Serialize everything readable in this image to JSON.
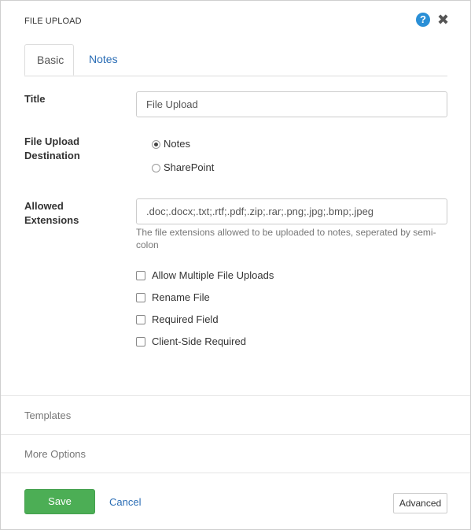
{
  "dialog": {
    "title": "FILE UPLOAD",
    "help_glyph": "?",
    "close_glyph": "✖"
  },
  "tabs": [
    {
      "label": "Basic",
      "active": true
    },
    {
      "label": "Notes",
      "active": false
    }
  ],
  "form": {
    "title": {
      "label": "Title",
      "value": "File Upload"
    },
    "destination": {
      "label_line1": "File Upload",
      "label_line2": "Destination",
      "options": [
        {
          "label": "Notes",
          "selected": true
        },
        {
          "label": "SharePoint",
          "selected": false
        }
      ]
    },
    "extensions": {
      "label_line1": "Allowed",
      "label_line2": "Extensions",
      "value": ".doc;.docx;.txt;.rtf;.pdf;.zip;.rar;.png;.jpg;.bmp;.jpeg",
      "help_text": "The file extensions allowed to be uploaded to notes, seperated by semi-colon"
    },
    "checkboxes": [
      {
        "label": "Allow Multiple File Uploads",
        "checked": false
      },
      {
        "label": "Rename File",
        "checked": false
      },
      {
        "label": "Required Field",
        "checked": false
      },
      {
        "label": "Client-Side Required",
        "checked": false
      }
    ]
  },
  "sections": {
    "templates": "Templates",
    "more_options": "More Options"
  },
  "footer": {
    "save_label": "Save",
    "cancel_label": "Cancel",
    "advanced_label": "Advanced"
  },
  "colors": {
    "primary": "#4cae55",
    "link": "#2a6db5",
    "help": "#2a8fd6"
  }
}
